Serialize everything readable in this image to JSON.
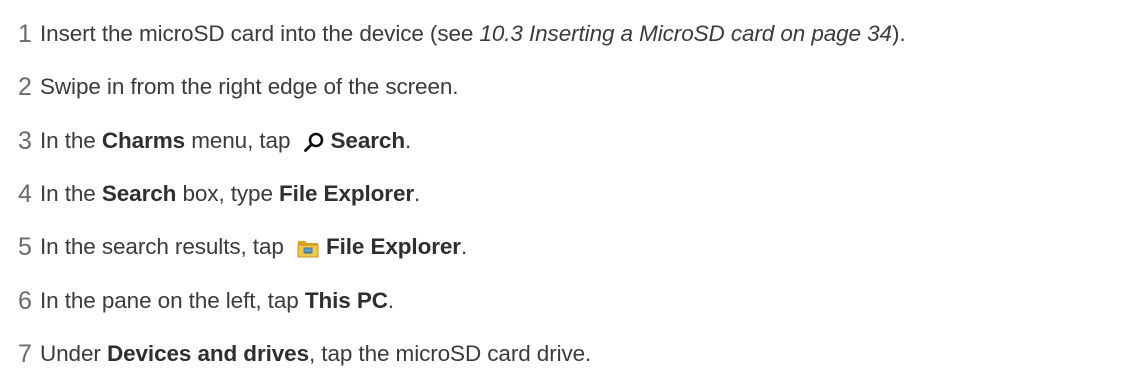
{
  "steps": [
    {
      "number": "1",
      "parts": [
        "Insert the microSD card into the device (see ",
        "10.3 Inserting a MicroSD card on page 34",
        ").",
        "",
        ""
      ]
    },
    {
      "number": "2",
      "parts": [
        "Swipe in from the right edge of the screen.",
        "",
        "",
        "",
        ""
      ]
    },
    {
      "number": "3",
      "parts": [
        "In the ",
        "Charms",
        " menu, tap ",
        "Search",
        "."
      ],
      "icon": "search-icon"
    },
    {
      "number": "4",
      "parts": [
        "In the ",
        "Search",
        " box, type ",
        "File Explorer",
        "."
      ]
    },
    {
      "number": "5",
      "parts": [
        "In the search results, tap ",
        "File Explorer",
        ".",
        "",
        ""
      ],
      "icon": "folder-icon"
    },
    {
      "number": "6",
      "parts": [
        "In the pane on the left, tap ",
        "This PC",
        ".",
        "",
        ""
      ]
    },
    {
      "number": "7",
      "parts": [
        "Under ",
        "Devices and drives",
        ", tap the microSD card drive.",
        "",
        ""
      ]
    }
  ],
  "colors": {
    "text": "#3b3b3b",
    "number": "#6b6b6b",
    "folder": "#e8b830"
  }
}
